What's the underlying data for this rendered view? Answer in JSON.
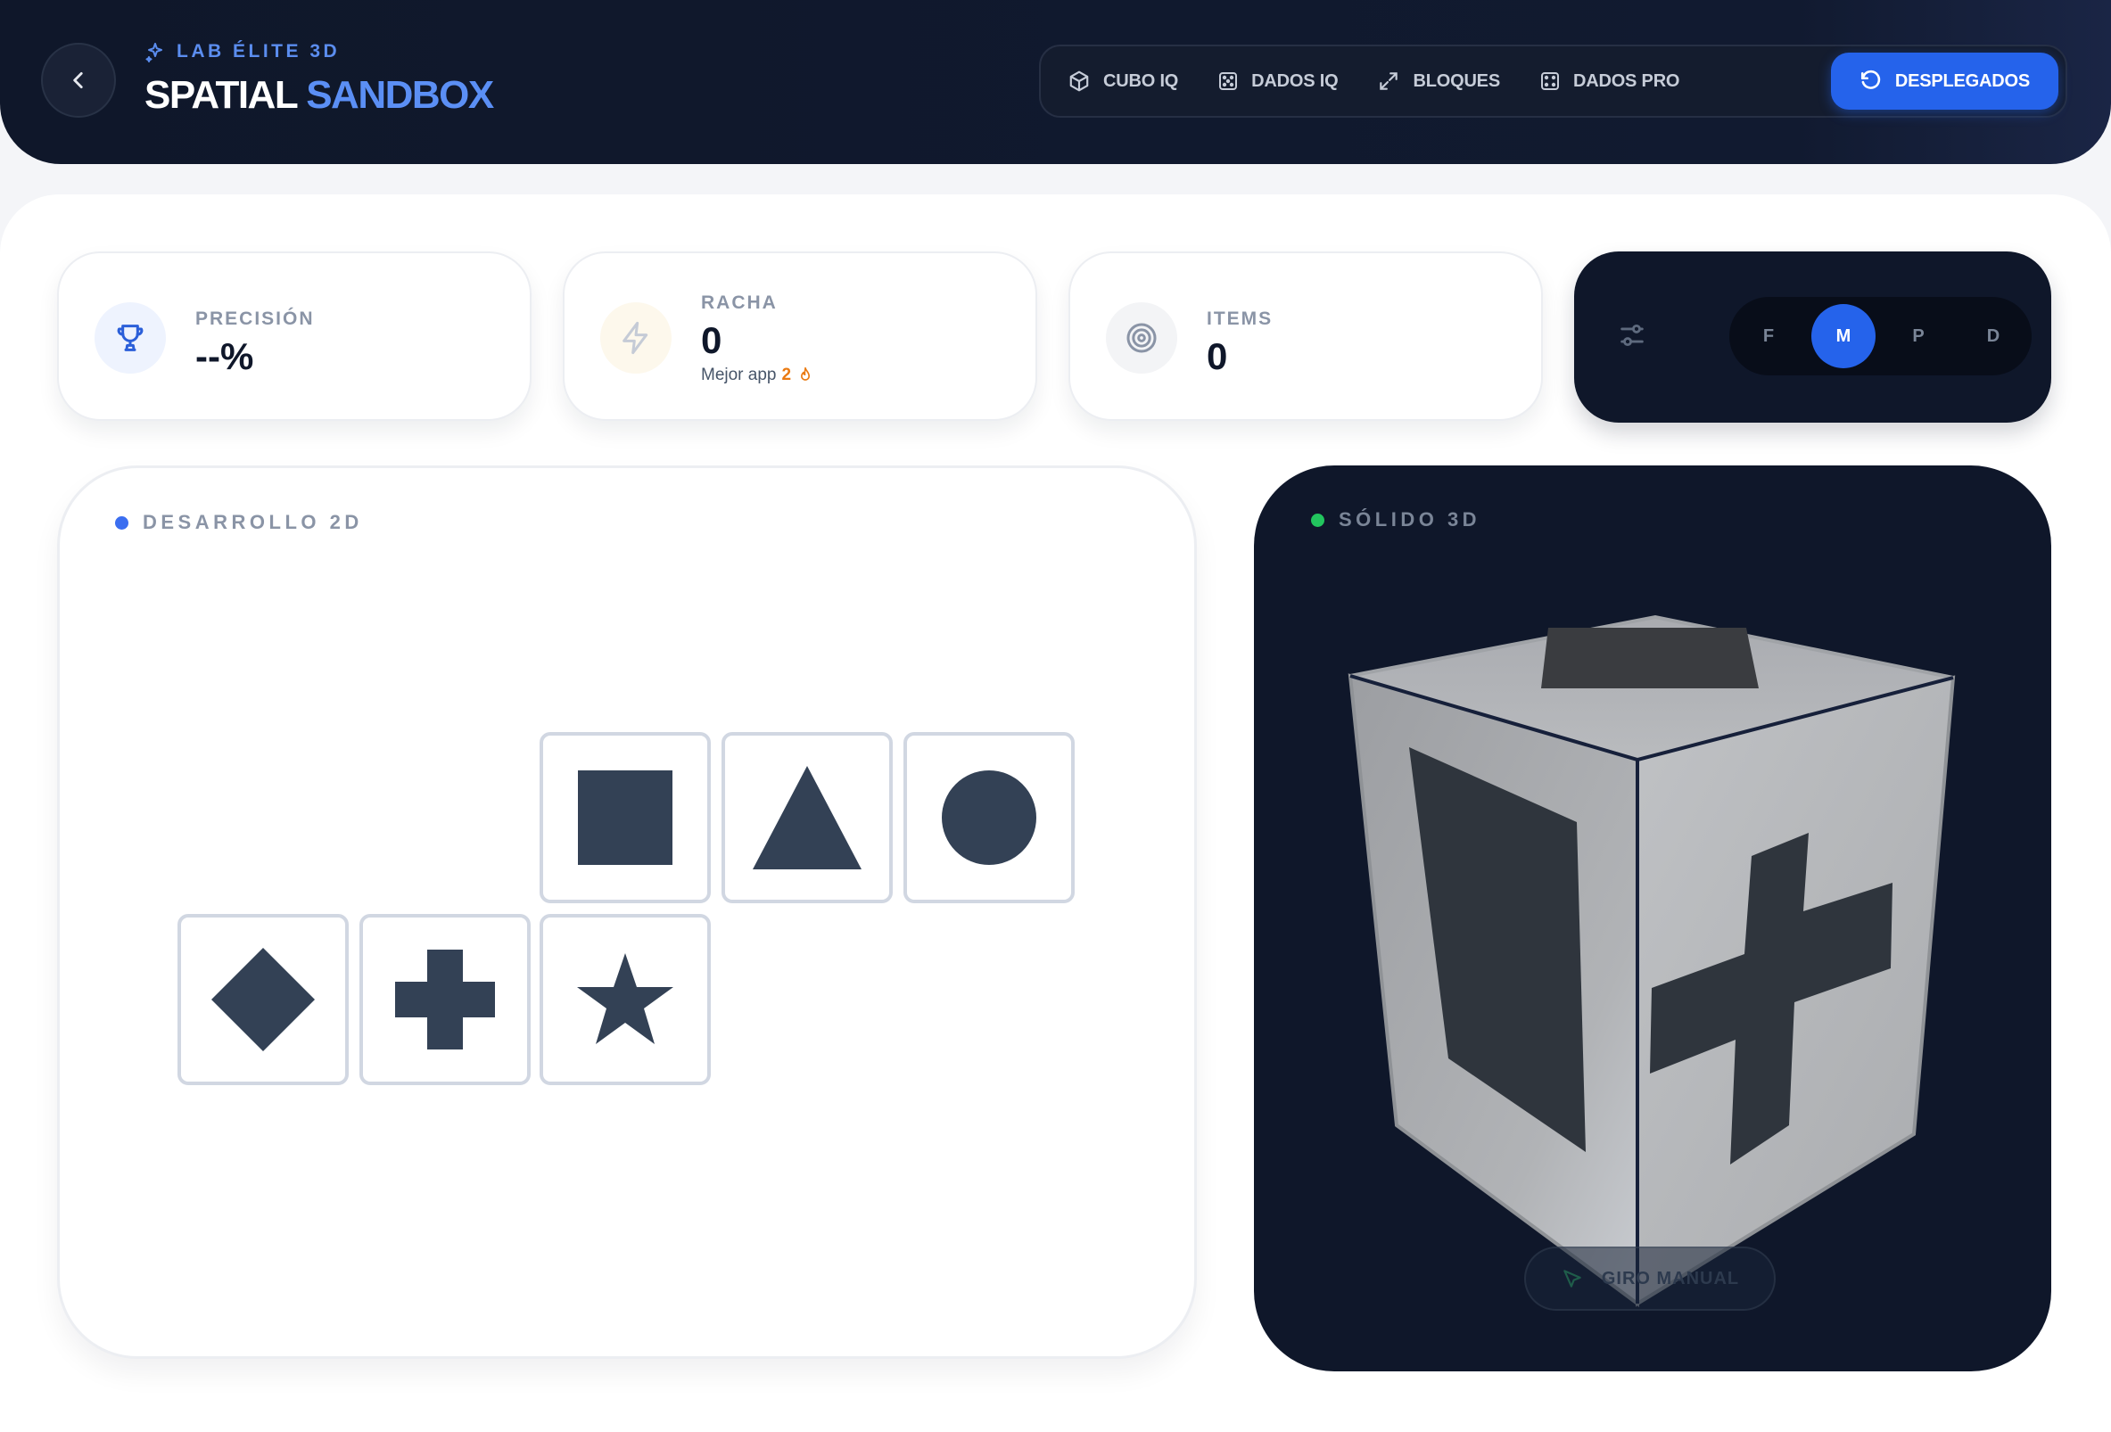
{
  "header": {
    "back_icon": "chevron-left-icon",
    "kicker": "LAB ÉLITE 3D",
    "title_main": "SPATIAL",
    "title_accent": "SANDBOX",
    "nav": [
      {
        "label": "CUBO IQ",
        "icon": "cube-icon"
      },
      {
        "label": "DADOS IQ",
        "icon": "dice-icon"
      },
      {
        "label": "BLOQUES",
        "icon": "expand-icon"
      },
      {
        "label": "DADOS PRO",
        "icon": "dice-icon"
      },
      {
        "label": "DESPLEGADOS",
        "icon": "rotate-ccw-icon",
        "active": true
      }
    ]
  },
  "stats": {
    "precision": {
      "label": "PRECISIÓN",
      "value": "--%",
      "icon": "trophy-icon"
    },
    "streak": {
      "label": "RACHA",
      "value": "0",
      "sub_label": "Mejor app",
      "sub_value": "2",
      "icon": "zap-icon",
      "sub_icon": "flame-icon"
    },
    "items": {
      "label": "ITEMS",
      "value": "0",
      "icon": "target-icon"
    }
  },
  "levels": {
    "icon": "sliders-icon",
    "options": [
      "F",
      "M",
      "P",
      "D"
    ],
    "selected": "M"
  },
  "net_panel": {
    "label": "DESARROLLO 2D",
    "dot_color": "#3b6ef0",
    "faces": [
      "square",
      "triangle",
      "circle",
      "diamond",
      "cross",
      "star"
    ]
  },
  "cube_panel": {
    "label": "SÓLIDO 3D",
    "dot_color": "#22c55e",
    "visible_faces": {
      "top": "square",
      "left": "square",
      "right": "cross"
    },
    "manual_button": "GIRO MANUAL",
    "manual_icon": "cursor-icon"
  },
  "colors": {
    "accent": "#2563eb",
    "dark": "#0f172a",
    "shape": "#334155",
    "flame": "#ea7a12"
  }
}
